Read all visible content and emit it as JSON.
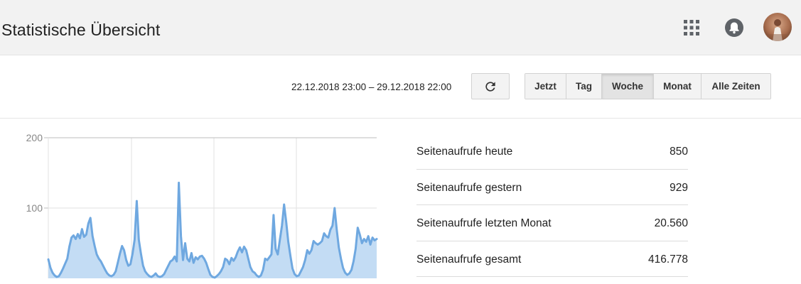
{
  "header": {
    "title": "Statistische Übersicht",
    "icons": [
      "apps-grid-icon",
      "notifications-bell-icon",
      "user-avatar"
    ]
  },
  "toolbar": {
    "date_range": "22.12.2018 23:00 – 29.12.2018 22:00",
    "refresh_icon": "refresh-icon",
    "ranges": [
      "Jetzt",
      "Tag",
      "Woche",
      "Monat",
      "Alle Zeiten"
    ],
    "selected_range": "Woche"
  },
  "chart_data": {
    "type": "area",
    "y_ticks": [
      "200",
      "100"
    ],
    "ylim": [
      0,
      200
    ],
    "grid": true,
    "color": "#6fa8e0",
    "fill": "#c3dcf4",
    "values": [
      27,
      15,
      8,
      4,
      2,
      3,
      8,
      14,
      21,
      28,
      45,
      58,
      61,
      56,
      63,
      57,
      70,
      59,
      62,
      78,
      86,
      60,
      46,
      34,
      28,
      24,
      18,
      12,
      7,
      4,
      3,
      5,
      10,
      22,
      35,
      46,
      40,
      26,
      18,
      20,
      35,
      55,
      110,
      55,
      35,
      18,
      10,
      6,
      3,
      2,
      4,
      7,
      3,
      2,
      3,
      6,
      12,
      18,
      24,
      26,
      31,
      24,
      136,
      60,
      26,
      50,
      28,
      24,
      36,
      22,
      30,
      27,
      31,
      32,
      28,
      22,
      13,
      5,
      2,
      1,
      3,
      6,
      10,
      16,
      28,
      26,
      20,
      29,
      25,
      30,
      38,
      44,
      37,
      45,
      40,
      28,
      16,
      10,
      8,
      4,
      2,
      4,
      12,
      28,
      26,
      30,
      34,
      90,
      42,
      34,
      55,
      75,
      105,
      80,
      52,
      32,
      14,
      6,
      3,
      4,
      10,
      16,
      26,
      40,
      35,
      40,
      53,
      50,
      48,
      50,
      53,
      64,
      60,
      58,
      69,
      75,
      100,
      70,
      44,
      28,
      15,
      8,
      5,
      7,
      12,
      24,
      42,
      72,
      62,
      50,
      56,
      52,
      60,
      48,
      58,
      54,
      56
    ]
  },
  "stats": {
    "rows": [
      {
        "label": "Seitenaufrufe heute",
        "value": "850"
      },
      {
        "label": "Seitenaufrufe gestern",
        "value": "929"
      },
      {
        "label": "Seitenaufrufe letzten Monat",
        "value": "20.560"
      },
      {
        "label": "Seitenaufrufe gesamt",
        "value": "416.778"
      }
    ]
  }
}
